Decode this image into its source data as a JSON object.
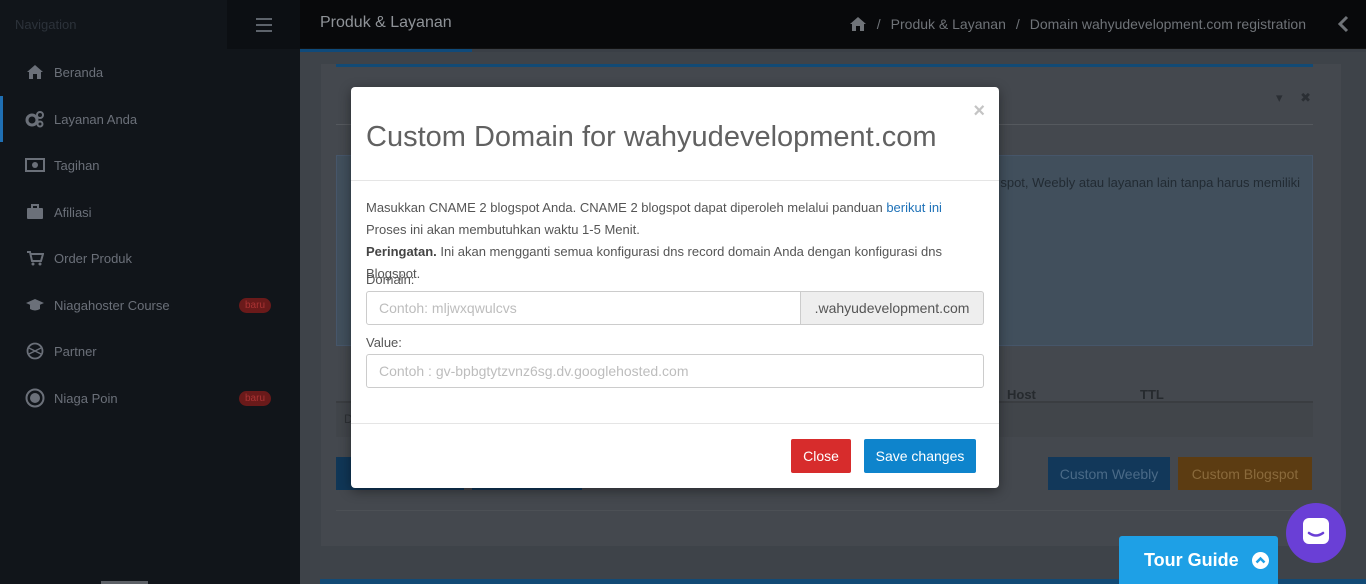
{
  "sidebar": {
    "nav_label": "Navigation",
    "items": [
      {
        "label": "Beranda",
        "icon": "home-icon"
      },
      {
        "label": "Layanan Anda",
        "icon": "cogs-icon",
        "active": true
      },
      {
        "label": "Tagihan",
        "icon": "money-icon"
      },
      {
        "label": "Afiliasi",
        "icon": "briefcase-icon"
      },
      {
        "label": "Order Produk",
        "icon": "cart-icon"
      },
      {
        "label": "Niagahoster Course",
        "icon": "graduation-cap-icon",
        "badge": "baru"
      },
      {
        "label": "Partner",
        "icon": "globe-icon"
      },
      {
        "label": "Niaga Poin",
        "icon": "coin-icon",
        "badge": "baru"
      }
    ]
  },
  "topbar": {
    "title": "Produk & Layanan",
    "breadcrumb": [
      "Produk & Layanan",
      "Domain wahyudevelopment.com registration"
    ],
    "breadcrumb_sep": "/"
  },
  "background": {
    "info_text": "spot, Weebly atau layanan lain tanpa harus memiliki",
    "table_headers": {
      "host": "Host",
      "ttl": "TTL"
    },
    "row_fragment": "D",
    "btn_weebly": "Custom Weebly",
    "btn_blogspot": "Custom Blogspot"
  },
  "modal": {
    "close_x": "×",
    "title": "Custom Domain for wahyudevelopment.com",
    "line1_text": "Masukkan CNAME 2 blogspot Anda. CNAME 2 blogspot dapat diperoleh melalui panduan ",
    "line1_link": "berikut ini",
    "line2": "Proses ini akan membutuhkan waktu 1-5 Menit.",
    "line3_bold": "Peringatan.",
    "line3_text": " Ini akan mengganti semua konfigurasi dns record domain Anda dengan konfigurasi dns Blogspot.",
    "domain_label": "Domain:",
    "domain_placeholder": "Contoh: mljwxqwulcvs",
    "domain_suffix": ".wahyudevelopment.com",
    "value_label": "Value:",
    "value_placeholder": "Contoh : gv-bpbgtytzvnz6sg.dv.googlehosted.com",
    "close_button": "Close",
    "save_button": "Save changes"
  },
  "tour": {
    "label": "Tour Guide"
  },
  "colors": {
    "primary": "#0e84cc",
    "danger": "#d72c2c",
    "tour": "#1ea0e6",
    "chat": "#6a3fd6"
  }
}
